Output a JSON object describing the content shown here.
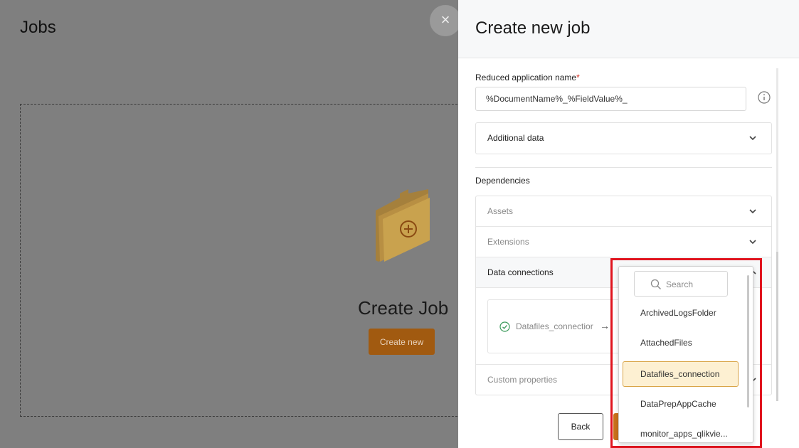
{
  "page": {
    "title": "Jobs",
    "empty_state_title": "Create Job",
    "create_new_label": "Create new",
    "close_glyph": "×"
  },
  "drawer": {
    "title": "Create new job",
    "reduced_name_label": "Reduced application name",
    "required_mark": "*",
    "reduced_name_value": "%DocumentName%_%FieldValue%_",
    "additional_data_label": "Additional data",
    "dependencies_label": "Dependencies",
    "accordion": {
      "assets": "Assets",
      "extensions": "Extensions",
      "data_connections": "Data connections",
      "custom_properties": "Custom properties"
    },
    "data_connection_card": {
      "name": "Datafiles_connectior",
      "arrow": "→"
    },
    "back_label": "Back"
  },
  "dropdown": {
    "search_placeholder": "Search",
    "options": [
      "ArchivedLogsFolder",
      "AttachedFiles",
      "Datafiles_connection",
      "DataPrepAppCache",
      "monitor_apps_qlikvie..."
    ],
    "selected_index": 2
  },
  "colors": {
    "accent": "#c9711a",
    "highlight": "#e0141e",
    "selected_bg": "#fdf0d2"
  }
}
